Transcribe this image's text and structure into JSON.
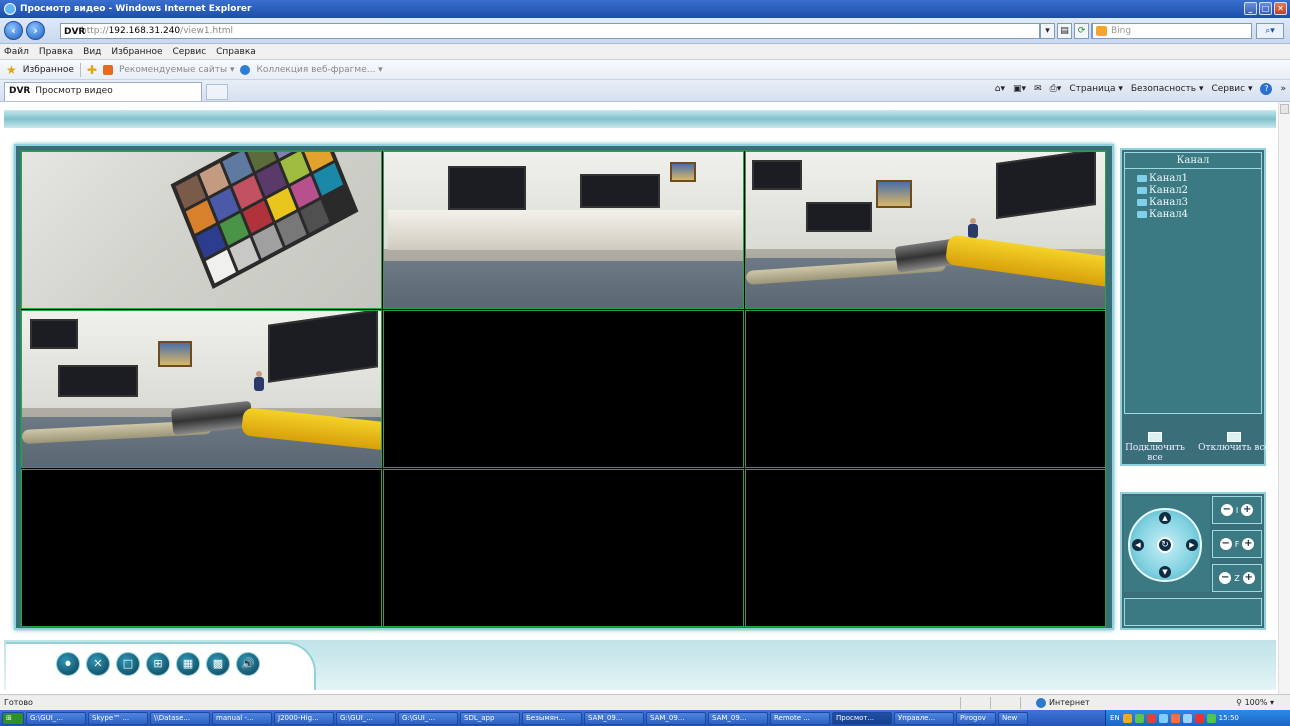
{
  "window": {
    "title": "Просмотр видео - Windows Internet Explorer",
    "buttons": [
      "_",
      "□",
      "✕"
    ]
  },
  "address": {
    "brand": "DVR",
    "scheme": "http://",
    "host": "192.168.31.240",
    "path": "/view1.html",
    "search_placeholder": "Bing"
  },
  "menu": [
    "Файл",
    "Правка",
    "Вид",
    "Избранное",
    "Сервис",
    "Справка"
  ],
  "favorites": {
    "label": "Избранное",
    "items": [
      "Рекомендуемые сайты ▾",
      "Коллекция веб-фрагме... ▾"
    ]
  },
  "tab": {
    "brand": "DVR",
    "title": "Просмотр видео"
  },
  "commandbar": [
    "Страница ▾",
    "Безопасность ▾",
    "Сервис ▾",
    "»"
  ],
  "channels": {
    "header": "Канал",
    "items": [
      "Канал1",
      "Канал2",
      "Канал3",
      "Канал4"
    ],
    "connect_all": "Подключить все",
    "disconnect_all": "Отключить все"
  },
  "ptz": {
    "rows": [
      "I",
      "F",
      "Z"
    ]
  },
  "toolbar": {
    "icons": [
      "record-icon",
      "settings-icon",
      "single-view-icon",
      "quad-view-icon",
      "nine-view-icon",
      "sixteen-view-icon",
      "volume-icon"
    ]
  },
  "status": {
    "left": "Готово",
    "zone": "Интернет",
    "zoom": "100%"
  },
  "taskbar": {
    "items": [
      "G:\\GUI_...",
      "Skype™ ...",
      "\\\\Datase...",
      "manual -...",
      "J2000-Hig...",
      "G:\\GUI_...",
      "G:\\GUI_...",
      "SDL_app",
      "Безымян...",
      "SAM_09...",
      "SAM_09...",
      "SAM_09...",
      "Remote ...",
      "Просмот...",
      "Управле...",
      "Pirogov",
      "New"
    ],
    "active_index": 13,
    "lang": "EN",
    "clock": "15:50"
  },
  "colors": {
    "panel": "#3a6f79",
    "panel_border": "#8fd2db",
    "grid_line": "#2ba04b"
  }
}
